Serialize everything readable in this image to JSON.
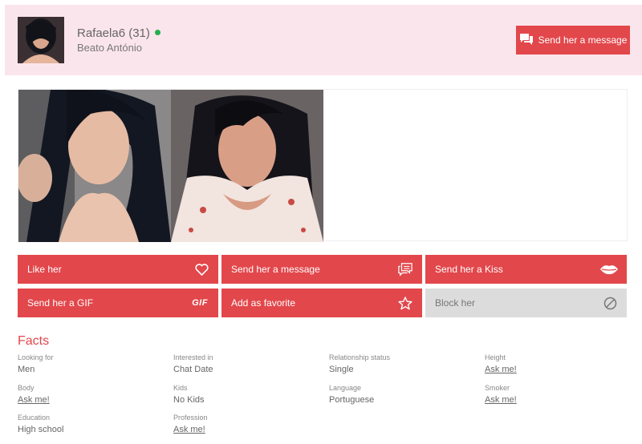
{
  "profile": {
    "name": "Rafaela6 (31)",
    "location": "Beato António",
    "send_message_label": "Send her a message"
  },
  "actions": {
    "like": "Like her",
    "message": "Send her a message",
    "kiss": "Send her a Kiss",
    "gif": "Send her a GIF",
    "gif_icon_text": "GIF",
    "favorite": "Add as favorite",
    "block": "Block her"
  },
  "facts": {
    "title": "Facts",
    "items": [
      {
        "label": "Looking for",
        "value": "Men"
      },
      {
        "label": "Interested in",
        "value": "Chat Date"
      },
      {
        "label": "Relationship status",
        "value": "Single"
      },
      {
        "label": "Height",
        "value": "Ask me!"
      },
      {
        "label": "Body",
        "value": "Ask me!"
      },
      {
        "label": "Kids",
        "value": "No Kids"
      },
      {
        "label": "Language",
        "value": "Portuguese"
      },
      {
        "label": "Smoker",
        "value": "Ask me!"
      },
      {
        "label": "Education",
        "value": "High school"
      },
      {
        "label": "Profession",
        "value": "Ask me!"
      }
    ]
  },
  "colors": {
    "accent": "#e2474b",
    "header_bg": "#fbe5ec",
    "online": "#22b14c",
    "disabled": "#dcdcdc"
  },
  "icons": [
    "chat-bubbles-icon",
    "heart-icon",
    "message-icon",
    "lips-icon",
    "gif-icon",
    "star-icon",
    "block-icon"
  ]
}
